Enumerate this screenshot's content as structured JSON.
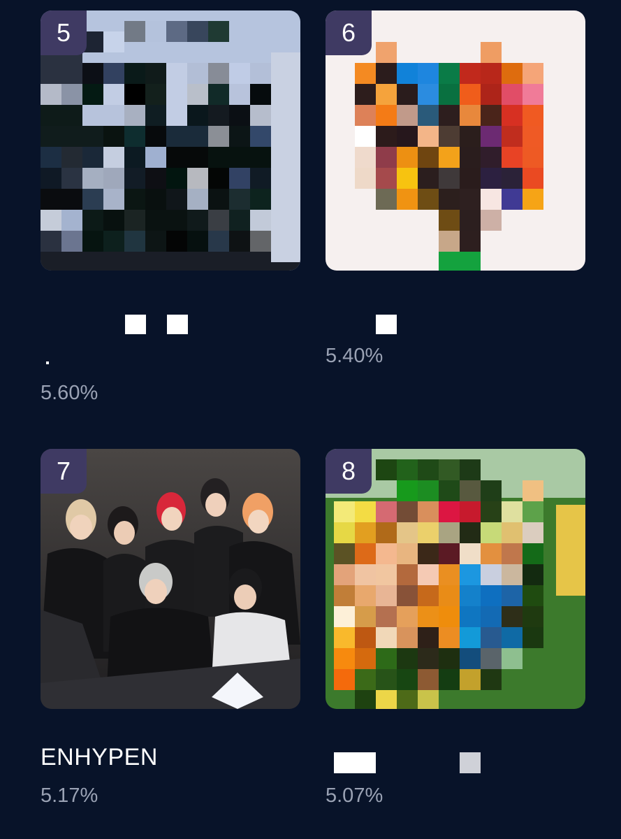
{
  "ranking": [
    {
      "rank": "5",
      "name": "",
      "percent": "5.60%"
    },
    {
      "rank": "6",
      "name": "",
      "percent": "5.40%"
    },
    {
      "rank": "7",
      "name": "ENHYPEN",
      "percent": "5.17%"
    },
    {
      "rank": "8",
      "name": "",
      "percent": "5.07%"
    }
  ],
  "colors": {
    "background": "#081329",
    "rank_badge": "#3f3a63",
    "percent_text": "#9aa2b4"
  }
}
